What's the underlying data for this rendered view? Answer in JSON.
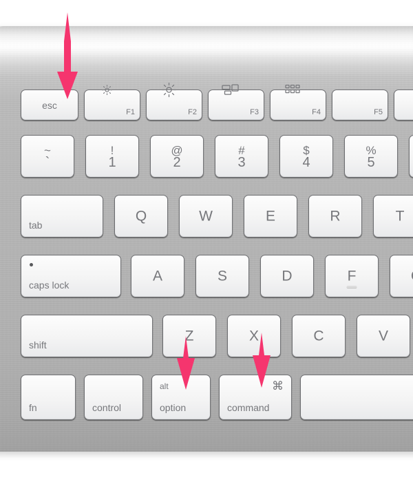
{
  "scene": {
    "subject": "apple-wireless-keyboard",
    "description": "Close-up photo of the left portion of a silver Apple Wireless Keyboard with pink annotation arrows pointing at the esc, option and command keys",
    "background_color": "#ffffff",
    "body_color": "#b8b8b8",
    "key_face_color": "#f4f4f4",
    "key_legend_color": "#76777b",
    "annotation_color": "#f5356e"
  },
  "keyboard": {
    "rows": [
      {
        "name": "function-row",
        "keys": [
          {
            "id": "esc",
            "label": "esc",
            "label_style": "word-center"
          },
          {
            "id": "f1",
            "label": "F1",
            "icon": "brightness-down-icon",
            "label_style": "fkey"
          },
          {
            "id": "f2",
            "label": "F2",
            "icon": "brightness-up-icon",
            "label_style": "fkey"
          },
          {
            "id": "f3",
            "label": "F3",
            "icon": "mission-control-icon",
            "label_style": "fkey"
          },
          {
            "id": "f4",
            "label": "F4",
            "icon": "launchpad-icon",
            "label_style": "fkey"
          },
          {
            "id": "f5",
            "label": "F5",
            "icon": "",
            "label_style": "fkey"
          },
          {
            "id": "f6",
            "label": "",
            "icon": "",
            "label_style": "fkey"
          }
        ]
      },
      {
        "name": "number-row",
        "keys": [
          {
            "id": "backtick",
            "upper": "~",
            "lower": "`"
          },
          {
            "id": "one",
            "upper": "!",
            "lower": "1"
          },
          {
            "id": "two",
            "upper": "@",
            "lower": "2"
          },
          {
            "id": "three",
            "upper": "#",
            "lower": "3"
          },
          {
            "id": "four",
            "upper": "$",
            "lower": "4"
          },
          {
            "id": "five",
            "upper": "%",
            "lower": "5"
          },
          {
            "id": "six",
            "upper": "",
            "lower": ""
          }
        ]
      },
      {
        "name": "qwerty-row",
        "keys": [
          {
            "id": "tab",
            "label": "tab",
            "label_style": "word-bottom-left"
          },
          {
            "id": "q",
            "label": "Q"
          },
          {
            "id": "w",
            "label": "W"
          },
          {
            "id": "e",
            "label": "E"
          },
          {
            "id": "r",
            "label": "R"
          },
          {
            "id": "t",
            "label": "T"
          }
        ]
      },
      {
        "name": "home-row",
        "keys": [
          {
            "id": "caps-lock",
            "label": "caps lock",
            "label_style": "word-bottom-left",
            "led": true
          },
          {
            "id": "a",
            "label": "A"
          },
          {
            "id": "s",
            "label": "S"
          },
          {
            "id": "d",
            "label": "D"
          },
          {
            "id": "f",
            "label": "F",
            "homing_bar": true
          },
          {
            "id": "g",
            "label": "G"
          }
        ]
      },
      {
        "name": "shift-row",
        "keys": [
          {
            "id": "shift",
            "label": "shift",
            "label_style": "word-bottom-left"
          },
          {
            "id": "z",
            "label": "Z"
          },
          {
            "id": "x",
            "label": "X"
          },
          {
            "id": "c",
            "label": "C"
          },
          {
            "id": "v",
            "label": "V"
          }
        ]
      },
      {
        "name": "bottom-row",
        "keys": [
          {
            "id": "fn",
            "label": "fn",
            "label_style": "word-bottom-left"
          },
          {
            "id": "control",
            "label": "control",
            "label_style": "word-bottom-left"
          },
          {
            "id": "option",
            "label": "option",
            "alt_label": "alt",
            "label_style": "word-bottom-left"
          },
          {
            "id": "command",
            "label": "command",
            "symbol": "⌘",
            "label_style": "word-bottom-left"
          },
          {
            "id": "space",
            "label": "",
            "label_style": "blank"
          }
        ]
      }
    ]
  },
  "annotations": {
    "color": "#f5356e",
    "arrows": [
      {
        "id": "arrow-esc",
        "points_to": "esc",
        "direction": "down"
      },
      {
        "id": "arrow-option",
        "points_to": "option",
        "direction": "down",
        "origin": "z-key"
      },
      {
        "id": "arrow-command",
        "points_to": "command",
        "direction": "down",
        "origin": "x-key"
      }
    ]
  }
}
